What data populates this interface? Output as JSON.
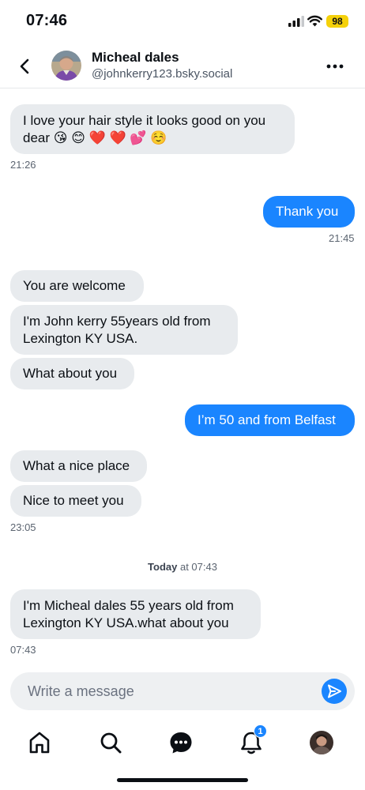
{
  "status_bar": {
    "time": "07:46",
    "battery": "98"
  },
  "header": {
    "name": "Micheal dales",
    "handle": "@johnkerry123.bsky.social",
    "back_icon": "chevron-left-icon",
    "more_icon": "more-horizontal-icon"
  },
  "messages": [
    {
      "dir": "in",
      "text": "I love your hair style it looks good on you dear 😘 😊 ❤️ ❤️ 💕 ☺️"
    },
    {
      "time": "21:26"
    },
    {
      "dir": "out",
      "text": "Thank you"
    },
    {
      "time": "21:45"
    },
    {
      "dir": "in",
      "text": "You are welcome"
    },
    {
      "dir": "in",
      "text": "I'm John kerry 55years old from Lexington KY USA."
    },
    {
      "dir": "in",
      "text": "What about you"
    },
    {
      "dir": "out",
      "text": "I’m 50 and from Belfast"
    },
    {
      "dir": "in",
      "text": "What a nice place"
    },
    {
      "dir": "in",
      "text": "Nice to meet you"
    },
    {
      "time": "23:05"
    },
    {
      "dir": "in",
      "text": "I'm Micheal dales 55 years old from Lexington KY USA.what about you"
    },
    {
      "time": "07:43"
    }
  ],
  "day_separator": {
    "day": "Today",
    "rest": " at 07:43"
  },
  "composer": {
    "placeholder": "Write a message",
    "send_icon": "send-icon"
  },
  "tab_bar": {
    "items": [
      "home-icon",
      "search-icon",
      "chat-icon",
      "notifications-icon",
      "profile-avatar"
    ],
    "notifications_badge": "1"
  },
  "colors": {
    "accent": "#1a85ff",
    "incoming_bubble": "#e8ebee",
    "battery": "#f5d10a"
  }
}
